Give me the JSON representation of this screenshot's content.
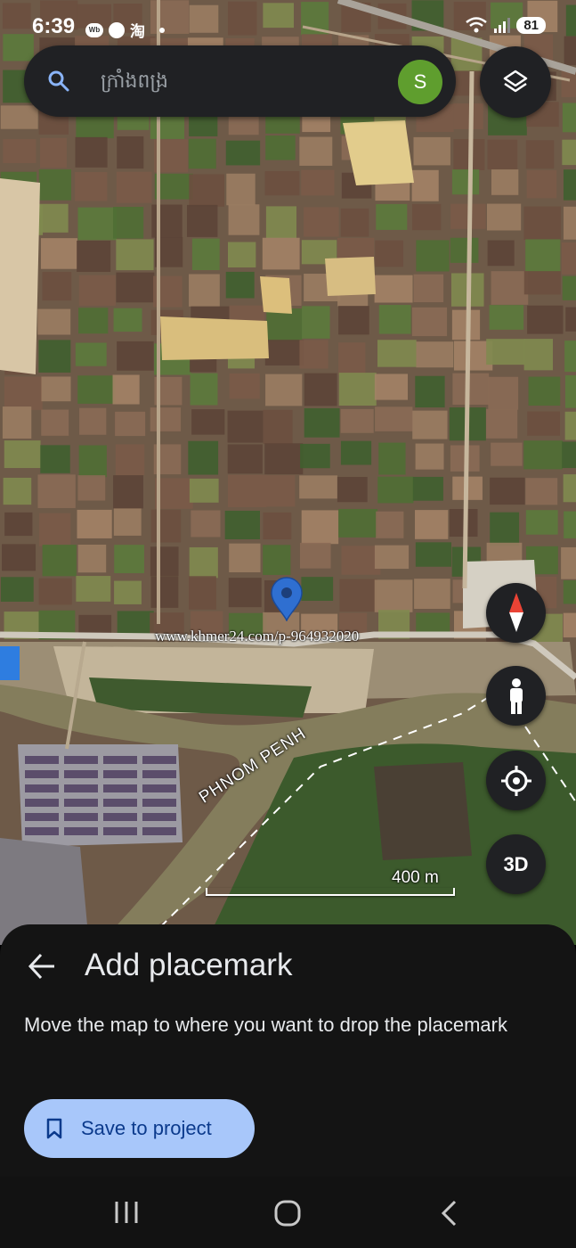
{
  "status_bar": {
    "time": "6:39",
    "app_icons": [
      "weibo-icon",
      "messenger-icon",
      "taobao-icon",
      "notification-dot-icon"
    ],
    "taobao_glyph": "淘",
    "battery": "81",
    "right_icons": [
      "wifi-icon",
      "signal-icon",
      "battery-icon"
    ]
  },
  "search": {
    "placeholder": "ក្រាំងពង្រ",
    "value": "",
    "avatar_letter": "S",
    "avatar_color": "#5f9e2e"
  },
  "map": {
    "road_label": "PHNOM PENH",
    "watermark": "www.khmer24.com/p-964932020",
    "scale_label": "400 m",
    "pin_color": "#2f6fd1"
  },
  "controls": {
    "layers": "layers-icon",
    "compass": "compass-icon",
    "street_view": "pegman-icon",
    "my_location": "my-location-icon",
    "three_d_label": "3D"
  },
  "sheet": {
    "title": "Add placemark",
    "description": "Move the map to where you want to drop the placemark",
    "save_label": "Save to project",
    "accent": "#a8c7fa"
  },
  "nav_bar": {
    "buttons": [
      "recents-icon",
      "home-icon",
      "back-icon"
    ]
  }
}
